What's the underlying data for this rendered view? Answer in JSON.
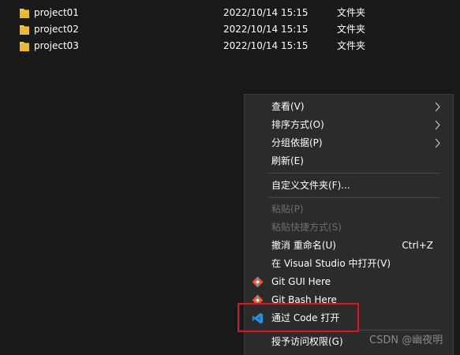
{
  "files": [
    {
      "name": "project01",
      "modified": "2022/10/14 15:15",
      "type": "文件夹",
      "icon": "folder-icon"
    },
    {
      "name": "project02",
      "modified": "2022/10/14 15:15",
      "type": "文件夹",
      "icon": "folder-icon"
    },
    {
      "name": "project03",
      "modified": "2022/10/14 15:15",
      "type": "文件夹",
      "icon": "folder-icon"
    }
  ],
  "context_menu": {
    "view": {
      "label": "查看(V)",
      "has_submenu": true
    },
    "sort_by": {
      "label": "排序方式(O)",
      "has_submenu": true
    },
    "group_by": {
      "label": "分组依据(P)",
      "has_submenu": true
    },
    "refresh": {
      "label": "刷新(E)"
    },
    "customize_folder": {
      "label": "自定义文件夹(F)..."
    },
    "paste": {
      "label": "粘贴(P)",
      "disabled": true
    },
    "paste_shortcut": {
      "label": "粘贴快捷方式(S)",
      "disabled": true
    },
    "undo_rename": {
      "label": "撤消 重命名(U)",
      "shortcut": "Ctrl+Z"
    },
    "open_in_vs": {
      "label": "在 Visual Studio 中打开(V)"
    },
    "git_gui": {
      "label": "Git GUI Here",
      "icon": "git-gui-icon"
    },
    "git_bash": {
      "label": "Git Bash Here",
      "icon": "git-bash-icon"
    },
    "open_with_code": {
      "label": "通过 Code 打开",
      "icon": "vscode-icon",
      "highlighted": true
    },
    "grant_access": {
      "label": "授予访问权限(G)",
      "has_submenu": true
    }
  },
  "watermark": "CSDN @幽夜明",
  "colors": {
    "background": "#191919",
    "menu_background": "#2b2b2b",
    "highlight_border": "#b8242b",
    "folder_yellow": "#f2c94c",
    "vscode_blue": "#2f8fd8"
  }
}
